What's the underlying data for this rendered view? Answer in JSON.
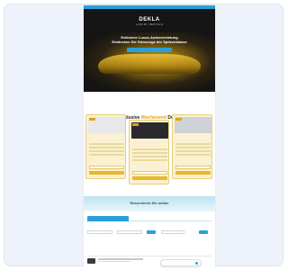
{
  "page": {
    "topbar_text": "",
    "logo_main": "DEKLA",
    "logo_sub": "LUXURY RENTALS",
    "hero_title": "Exklusive Luxus-Autovermietung",
    "hero_title_line2": "Entdecken Sie Fahrzeuge der Spitzenklasse",
    "hero_subtitle": "",
    "hero_button": "",
    "badge": "",
    "deals_title_prefix": "Exklusive",
    "deals_title_highlight": "Wochenend",
    "deals_title_suffix": "Deals",
    "deals_subtitle": "",
    "booking_title": "Reservieren Sie online",
    "booking_subtitle": "",
    "tab_active": "",
    "tab_other": "",
    "filter_label": "",
    "chat_label": ""
  },
  "cards": [
    {
      "name": "",
      "price": "",
      "image_color": "#e8e8ea",
      "accent": "#d9a514"
    },
    {
      "name": "",
      "price": "",
      "image_color": "#2a2a2e",
      "accent": "#d9a514"
    },
    {
      "name": "",
      "price": "",
      "image_color": "#cfd2d6",
      "accent": "#d9a514"
    }
  ],
  "colors": {
    "accent_blue": "#2a9fd8",
    "gold": "#e7b92a",
    "hero_bg": "#151515"
  }
}
